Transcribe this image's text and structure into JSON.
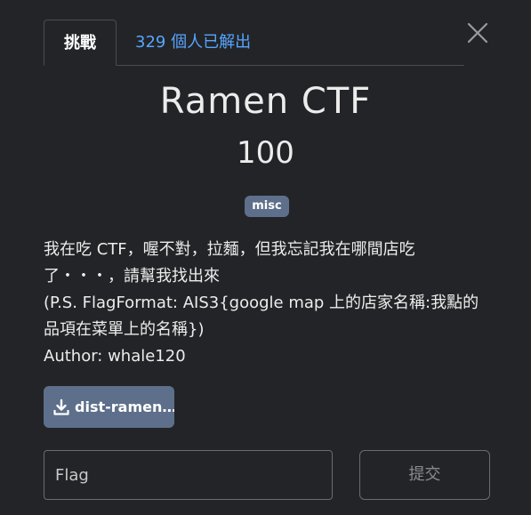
{
  "tabs": {
    "challenge_label": "挑戰",
    "solves_label": "329 個人已解出"
  },
  "challenge": {
    "name": "Ramen CTF",
    "points": "100",
    "tag": "misc",
    "description_lines": [
      "我在吃 CTF，喔不對，拉麵，但我忘記我在哪間店吃",
      "了・・・，請幫我找出來",
      "(P.S. FlagFormat: AIS3{google map 上的店家名稱:我點的",
      "品項在菜單上的名稱})",
      "Author: whale120"
    ],
    "file_label": "dist-ramen…"
  },
  "form": {
    "flag_placeholder": "Flag",
    "submit_label": "提交"
  },
  "colors": {
    "background": "#232427",
    "accent_link": "#56a6ff",
    "tag_bg": "#5d6f8a"
  },
  "icons": {
    "close": "close-icon",
    "download": "download-icon"
  }
}
